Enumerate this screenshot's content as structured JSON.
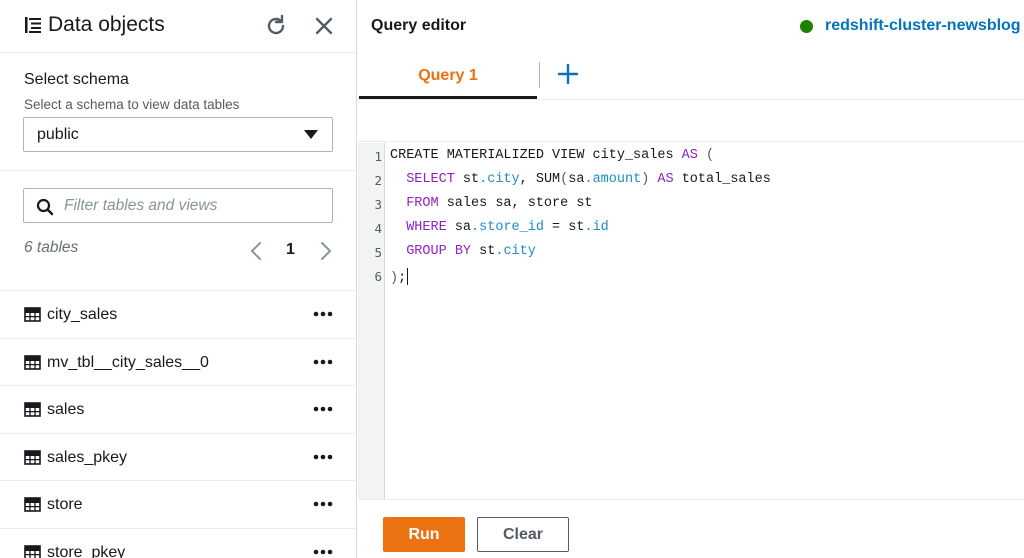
{
  "data_objects": {
    "title": "Data objects",
    "icons": {
      "title": "data-objects-icon",
      "refresh": "refresh-icon",
      "close": "close-icon"
    },
    "schema_label": "Select schema",
    "schema_description": "Select a schema to view data tables",
    "schema_selected": "public",
    "filter_placeholder": "Filter tables and views",
    "table_count": "6 tables",
    "pagination": {
      "current_page": "1"
    },
    "tables": [
      {
        "name": "city_sales"
      },
      {
        "name": "mv_tbl__city_sales__0"
      },
      {
        "name": "sales"
      },
      {
        "name": "sales_pkey"
      },
      {
        "name": "store"
      },
      {
        "name": "store_pkey"
      }
    ]
  },
  "query_editor": {
    "title": "Query editor",
    "cluster_name": "redshift-cluster-newsblog",
    "cluster_status_color": "#1d8102",
    "tabs": [
      {
        "label": "Query 1",
        "active": true
      }
    ],
    "accent_color": "#ec7211",
    "line_numbers": [
      "1",
      "2",
      "3",
      "4",
      "5",
      "6"
    ],
    "code_lines": [
      "CREATE MATERIALIZED VIEW city_sales AS (",
      "  SELECT st.city, SUM(sa.amount) AS total_sales",
      "  FROM sales sa, store st",
      "  WHERE sa.store_id = st.id",
      "  GROUP BY st.city",
      ");"
    ],
    "run_label": "Run",
    "clear_label": "Clear"
  }
}
